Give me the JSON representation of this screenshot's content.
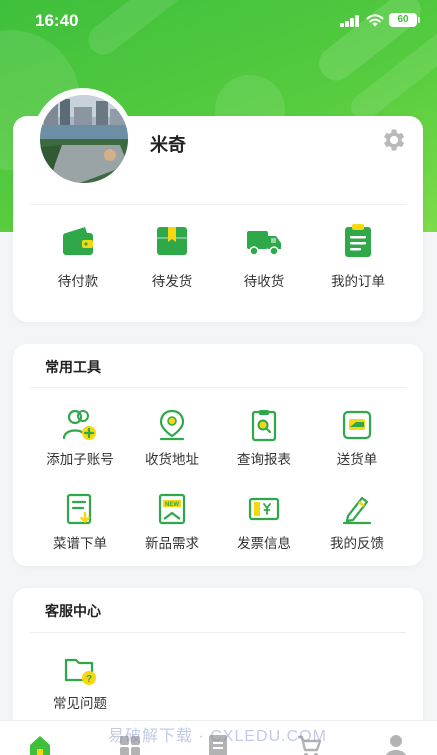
{
  "status_bar": {
    "time": "16:40",
    "battery": "60"
  },
  "profile": {
    "name": "米奇"
  },
  "orders": [
    {
      "label": "待付款",
      "icon": "wallet-icon"
    },
    {
      "label": "待发货",
      "icon": "box-icon"
    },
    {
      "label": "待收货",
      "icon": "truck-icon"
    },
    {
      "label": "我的订单",
      "icon": "clipboard-icon"
    }
  ],
  "tools": {
    "title": "常用工具",
    "items": [
      {
        "label": "添加子账号",
        "icon": "add-user-icon"
      },
      {
        "label": "收货地址",
        "icon": "location-pin-icon"
      },
      {
        "label": "查询报表",
        "icon": "report-search-icon"
      },
      {
        "label": "送货单",
        "icon": "delivery-slip-icon"
      },
      {
        "label": "菜谱下单",
        "icon": "recipe-order-icon"
      },
      {
        "label": "新品需求",
        "icon": "new-product-icon"
      },
      {
        "label": "发票信息",
        "icon": "invoice-icon"
      },
      {
        "label": "我的反馈",
        "icon": "feedback-pen-icon"
      }
    ]
  },
  "service": {
    "title": "客服中心",
    "items": [
      {
        "label": "常见问题",
        "icon": "faq-folder-icon"
      }
    ]
  },
  "tabbar": [
    "home-icon",
    "category-icon",
    "list-icon",
    "cart-icon",
    "user-icon"
  ],
  "watermark": "易破解下载 · CXLEDU.COM",
  "colors": {
    "brand_green": "#3fbf3c",
    "icon_green": "#2fa84a",
    "accent_yellow": "#f5d80f"
  }
}
